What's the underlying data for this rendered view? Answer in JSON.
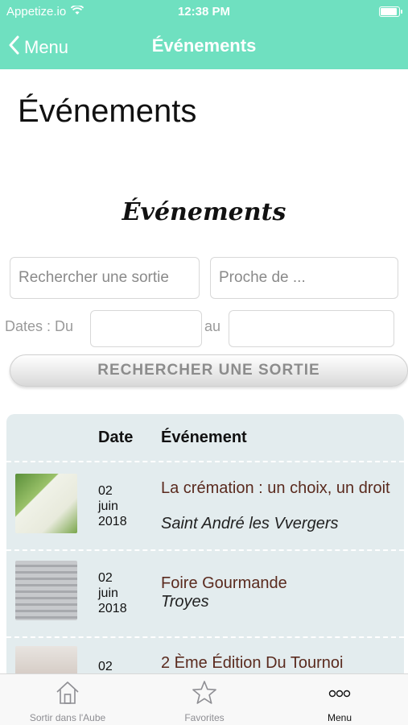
{
  "status_bar": {
    "carrier": "Appetize.io",
    "time": "12:38 PM"
  },
  "nav": {
    "back_label": "Menu",
    "title": "Événements"
  },
  "page": {
    "title": "Événements",
    "section_title": "Événements"
  },
  "search": {
    "query_placeholder": "Rechercher une sortie",
    "near_placeholder": "Proche de ...",
    "dates_label": "Dates : Du",
    "to_label": "au",
    "button_label": "RECHERCHER UNE SORTIE"
  },
  "table": {
    "headers": {
      "date": "Date",
      "event": "Événement"
    },
    "rows": [
      {
        "date": "02\njuin\n2018",
        "title": "La crémation : un choix, un droit",
        "city": "Saint André les Vvergers"
      },
      {
        "date": "02\njuin\n2018",
        "title": "Foire Gourmande",
        "city": "Troyes"
      },
      {
        "date": "02",
        "title": "2 Ème Édition Du Tournoi",
        "city": ""
      }
    ]
  },
  "tabs": [
    {
      "label": "Sortir dans l'Aube",
      "icon": "house-icon"
    },
    {
      "label": "Favorites",
      "icon": "star-icon"
    },
    {
      "label": "Menu",
      "icon": "more-icon"
    }
  ],
  "colors": {
    "accent": "#6fe0c0",
    "table_background": "#e3ecee",
    "event_title": "#5a2a1e"
  }
}
